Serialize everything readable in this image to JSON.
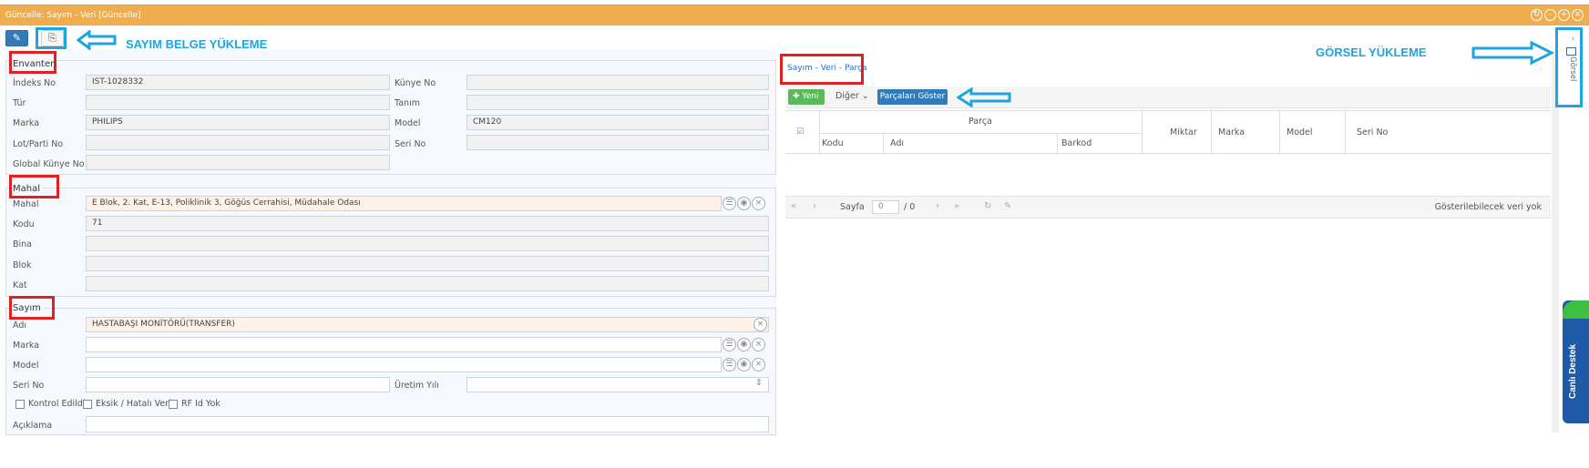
{
  "window": {
    "title": "Güncelle: Sayım - Veri [Güncelle]"
  },
  "annotations": {
    "upload_doc": "SAYIM BELGE YÜKLEME",
    "upload_image": "GÖRSEL YÜKLEME"
  },
  "envanter": {
    "legend": "Envanter",
    "indeks_label": "İndeks No",
    "indeks_value": "IST-1028332",
    "kunye_label": "Künye No",
    "kunye_value": "",
    "tur_label": "Tür",
    "tanim_label": "Tanım",
    "marka_label": "Marka",
    "marka_value": "PHILIPS",
    "model_label": "Model",
    "model_value": "CM120",
    "lot_label": "Lot/Parti No",
    "seri_label": "Seri No",
    "global_label": "Global Künye No"
  },
  "mahal": {
    "legend": "Mahal",
    "mahal_label": "Mahal",
    "mahal_value": "E Blok, 2. Kat, E-13, Poliklinik 3, Göğüs Cerrahisi, Müdahale Odası",
    "kodu_label": "Kodu",
    "kodu_value": "71",
    "bina_label": "Bina",
    "blok_label": "Blok",
    "kat_label": "Kat"
  },
  "sayim": {
    "legend": "Sayım",
    "adi_label": "Adı",
    "adi_value": "HASTABAŞI MONİTÖRÜ(TRANSFER)",
    "marka_label": "Marka",
    "model_label": "Model",
    "seri_label": "Seri No",
    "uretim_label": "Üretim Yılı",
    "check1": "Kontrol Edildi?",
    "check2": "Eksik / Hatalı Veri?",
    "check3": "RF Id Yok",
    "aciklama_label": "Açıklama"
  },
  "right": {
    "tab": "Sayım - Veri - Parça",
    "new_btn": "Yeni",
    "other_btn": "Diğer",
    "parts_btn": "Parçaları Göster",
    "grid": {
      "group_header": "Parça",
      "col_kodu": "Kodu",
      "col_adi": "Adı",
      "col_barkod": "Barkod",
      "col_miktar": "Miktar",
      "col_marka": "Marka",
      "col_model": "Model",
      "col_serino": "Seri No"
    },
    "pager": {
      "page_label": "Sayfa",
      "page_value": "0",
      "of_total": "/ 0",
      "empty_msg": "Gösterilebilecek veri yok"
    }
  },
  "side": {
    "gorsel": "Görsel",
    "live_support": "Canlı Destek"
  },
  "colors": {
    "titlebar": "#f0ad4e",
    "primary": "#337ab7",
    "success": "#5cb85c",
    "annotation_red": "#e12020",
    "annotation_blue": "#1ea5e0"
  }
}
